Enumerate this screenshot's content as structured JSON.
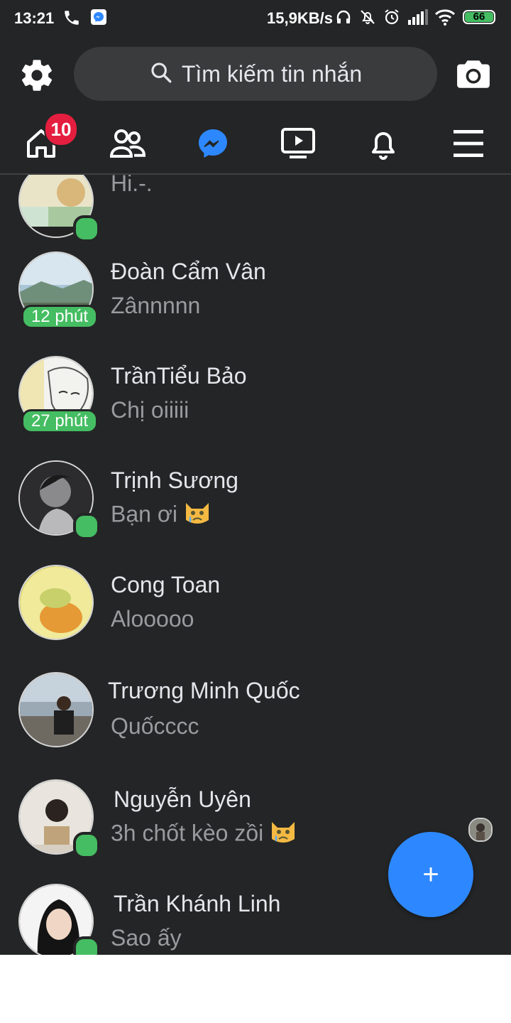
{
  "status_bar": {
    "time": "13:21",
    "network_speed": "15,9KB/s",
    "battery": "66",
    "icons": [
      "phone-icon",
      "messenger-icon",
      "headset-icon",
      "muted-bell-icon",
      "alarm-icon",
      "signal-icon",
      "wifi-icon",
      "battery-icon"
    ]
  },
  "header": {
    "search_placeholder": "Tìm kiếm tin nhắn",
    "icons": [
      "gear-icon",
      "search-icon",
      "camera-icon"
    ]
  },
  "nav": {
    "home_badge": "10",
    "tabs": [
      "home-icon",
      "friends-icon",
      "messenger-icon",
      "watch-icon",
      "bell-icon",
      "menu-icon"
    ],
    "active_tab": "messenger",
    "accent_color": "#2d88ff"
  },
  "chats": [
    {
      "name": "",
      "preview": "Hi.-.",
      "status": "online"
    },
    {
      "name": "Đoàn Cẩm Vân",
      "preview": "Zânnnnn",
      "status": "12 phút"
    },
    {
      "name": "TrầnTiểu Bảo",
      "preview": "Chị oiiiii",
      "status": "27 phút"
    },
    {
      "name": "Trịnh Sương",
      "preview": "Bạn ơi",
      "status": "online",
      "emoji": "crying-cat-emoji"
    },
    {
      "name": "Cong Toan",
      "preview": "Alooooo",
      "status": ""
    },
    {
      "name": "Trương Minh Quốc",
      "preview": "Quốcccc",
      "status": ""
    },
    {
      "name": "Nguyễn Uyên",
      "preview": "3h chốt kèo zồi",
      "status": "online",
      "emoji": "crying-cat-emoji"
    },
    {
      "name": "Trần Khánh Linh",
      "preview": "Sao ấy",
      "status": "online"
    }
  ],
  "fab": {
    "label": "+"
  },
  "colors": {
    "background": "#242526",
    "online": "#45bd62",
    "badge": "#e41e3f"
  }
}
